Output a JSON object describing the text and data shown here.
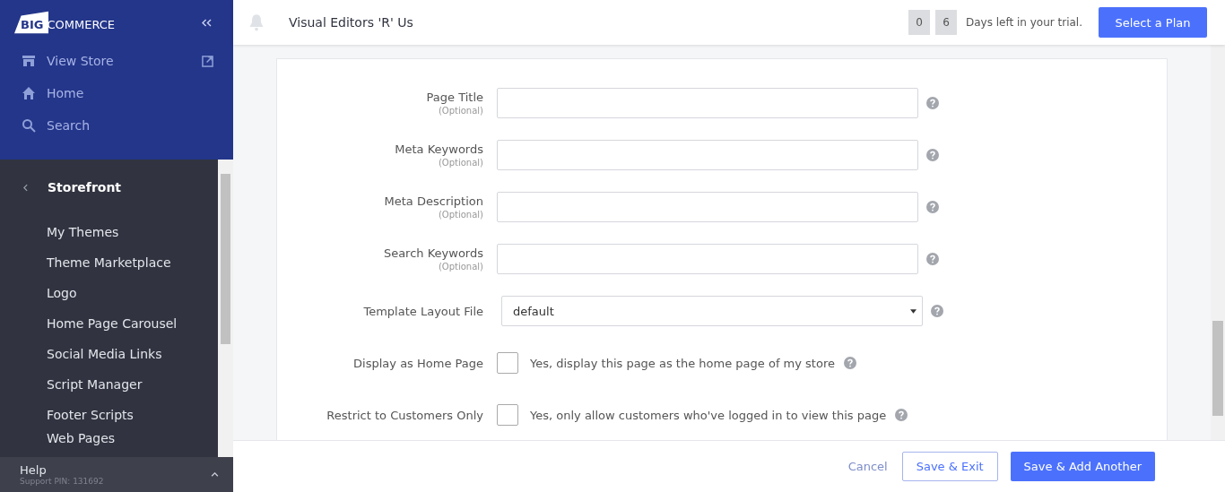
{
  "sidebar": {
    "logo": {
      "prefix": "BIG",
      "name": "COMMERCE"
    },
    "top_links": [
      {
        "kind": "store",
        "label": "View Store",
        "external": true
      },
      {
        "kind": "home",
        "label": "Home",
        "external": false
      },
      {
        "kind": "search",
        "label": "Search",
        "external": false
      }
    ],
    "section": {
      "title": "Storefront"
    },
    "items": [
      "My Themes",
      "Theme Marketplace",
      "Logo",
      "Home Page Carousel",
      "Social Media Links",
      "Script Manager",
      "Footer Scripts",
      "Web Pages"
    ],
    "help": {
      "title": "Help",
      "subtitle": "Support PIN: 131692"
    }
  },
  "header": {
    "store_name": "Visual Editors 'R' Us",
    "trial_digits": [
      "0",
      "6"
    ],
    "trial_text": "Days left in your trial.",
    "plan_button": "Select a Plan"
  },
  "form": {
    "fields": [
      {
        "kind": "text",
        "label": "Page Title",
        "hint": "(Optional)"
      },
      {
        "kind": "text",
        "label": "Meta Keywords",
        "hint": "(Optional)"
      },
      {
        "kind": "text",
        "label": "Meta Description",
        "hint": "(Optional)"
      },
      {
        "kind": "text",
        "label": "Search Keywords",
        "hint": "(Optional)"
      },
      {
        "kind": "select",
        "label": "Template Layout File",
        "value": "default"
      },
      {
        "kind": "checkbox",
        "label": "Display as Home Page",
        "checked": false,
        "text": "Yes, display this page as the home page of my store"
      },
      {
        "kind": "checkbox",
        "label": "Restrict to Customers Only",
        "checked": false,
        "text": "Yes, only allow customers who've logged in to view this page"
      }
    ]
  },
  "footer": {
    "cancel": "Cancel",
    "save_exit": "Save & Exit",
    "save_add": "Save & Add Another"
  }
}
